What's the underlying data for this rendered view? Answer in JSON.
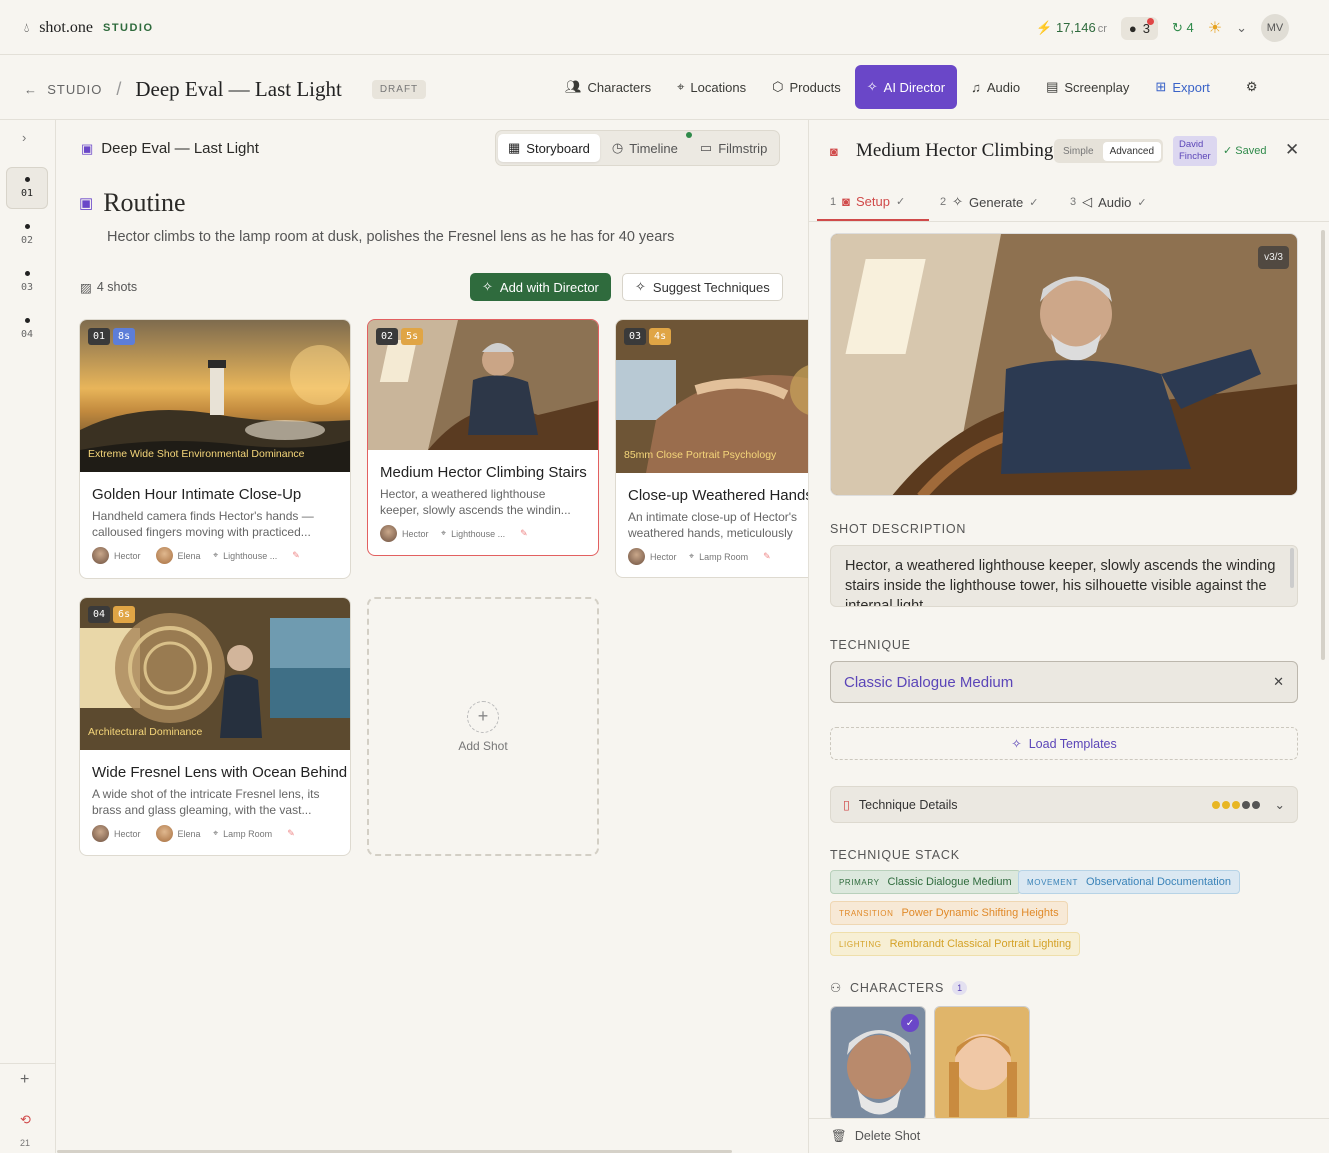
{
  "app": {
    "logo_name": "shot.one",
    "logo_studio": "STUDIO",
    "credits": "17,146",
    "credits_unit": "cr",
    "chat_count": "3",
    "sync_count": "4",
    "user_initials": "MV"
  },
  "nav": {
    "back": "STUDIO",
    "project": "Deep Eval — Last Light",
    "status": "DRAFT",
    "tabs": [
      "Characters",
      "Locations",
      "Products",
      "AI Director",
      "Audio",
      "Screenplay",
      "Export"
    ]
  },
  "rail": {
    "items": [
      "01",
      "02",
      "03",
      "04"
    ],
    "history_count": "21"
  },
  "main": {
    "project": "Deep Eval — Last Light",
    "views": [
      "Storyboard",
      "Timeline",
      "Filmstrip"
    ],
    "scene_title": "Routine",
    "scene_desc": "Hector climbs to the lamp room at dusk, polishes the Fresnel lens as he has for 40 years",
    "shot_count": "4 shots",
    "add_director": "Add with Director",
    "suggest": "Suggest Techniques",
    "add_shot": "Add Shot",
    "shots": [
      {
        "num": "01",
        "dur": "8s",
        "caption": "Extreme Wide Shot Environmental Dominance",
        "title": "Golden Hour Intimate Close-Up",
        "desc": "Handheld camera finds Hector's hands — calloused fingers moving with practiced...",
        "c1": "Hector",
        "c2": "Elena",
        "loc": "Lighthouse ..."
      },
      {
        "num": "02",
        "dur": "5s",
        "caption": "",
        "title": "Medium Hector Climbing Stairs",
        "desc": "Hector, a weathered lighthouse keeper, slowly ascends the windin...",
        "c1": "Hector",
        "loc": "Lighthouse ..."
      },
      {
        "num": "03",
        "dur": "4s",
        "caption": "85mm Close Portrait Psychology",
        "title": "Close-up Weathered Hands",
        "desc": "An intimate close-up of Hector's weathered hands, meticulously",
        "c1": "Hector",
        "loc": "Lamp Room"
      },
      {
        "num": "04",
        "dur": "6s",
        "caption": "Architectural Dominance",
        "title": "Wide Fresnel Lens with Ocean Behind",
        "desc": "A wide shot of the intricate Fresnel lens, its brass and glass gleaming, with the vast...",
        "c1": "Hector",
        "c2": "Elena",
        "loc": "Lamp Room"
      }
    ]
  },
  "panel": {
    "title": "Medium Hector Climbing Stairs",
    "mode_simple": "Simple",
    "mode_advanced": "Advanced",
    "director": "David Fincher",
    "saved": "Saved",
    "steps": [
      {
        "n": "1",
        "label": "Setup"
      },
      {
        "n": "2",
        "label": "Generate"
      },
      {
        "n": "3",
        "label": "Audio"
      }
    ],
    "version": "v3/3",
    "desc_label": "SHOT DESCRIPTION",
    "desc": "Hector, a weathered lighthouse keeper, slowly ascends the winding stairs inside the lighthouse tower, his silhouette visible against the internal light",
    "tech_label": "TECHNIQUE",
    "technique": "Classic Dialogue Medium",
    "load": "Load Templates",
    "details": "Technique Details",
    "stack_label": "TECHNIQUE STACK",
    "stack": [
      {
        "k": "PRIMARY",
        "v": "Classic Dialogue Medium"
      },
      {
        "k": "MOVEMENT",
        "v": "Observational Documentation"
      },
      {
        "k": "TRANSITION",
        "v": "Power Dynamic Shifting Heights"
      },
      {
        "k": "LIGHTING",
        "v": "Rembrandt Classical Portrait Lighting"
      }
    ],
    "char_label": "CHARACTERS",
    "char_count": "1",
    "delete": "Delete Shot"
  },
  "colors": {
    "accent": "#6a47c8",
    "green": "#2f6b3d",
    "red": "#d04a4a"
  }
}
